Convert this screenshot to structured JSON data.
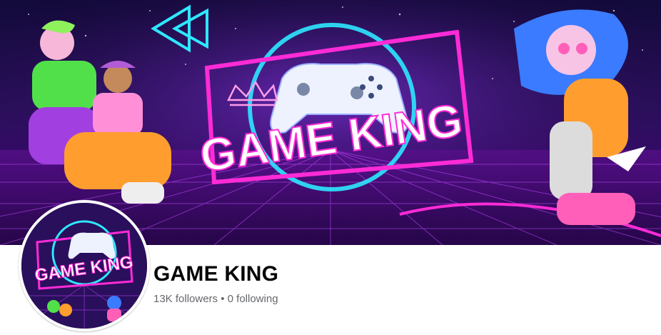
{
  "cover": {
    "logo_text": "GAME KING",
    "accent_pink": "#ff2bd6",
    "accent_cyan": "#2ee8ff",
    "background": "#1b0a4a"
  },
  "profile": {
    "logo_text": "GAME KING"
  },
  "page": {
    "name": "GAME KING",
    "followers": "13K followers",
    "separator": "•",
    "following": "0 following"
  },
  "colors": {
    "name_text": "#050505",
    "secondary_text": "#65676b"
  }
}
